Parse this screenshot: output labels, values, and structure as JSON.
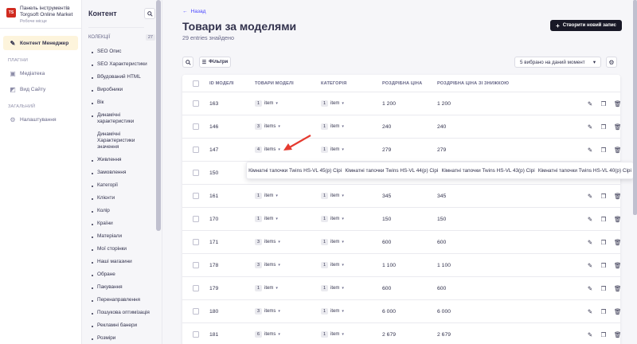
{
  "brand": {
    "title_line1": "Панель інструментів",
    "title_line2": "Torgsoft Online Market",
    "subtitle": "Робоче місце",
    "logo_text": "TS"
  },
  "nav": {
    "content_manager": "Контент Менеджер",
    "plugins_section": "ПЛАГІНИ",
    "media": "Медіатека",
    "site_view": "Вид Сайту",
    "general_section": "ЗАГАЛЬНИЙ",
    "settings": "Налаштування"
  },
  "subnav": {
    "title": "Контент",
    "collections_label": "КОЛЕКЦІЇ",
    "collections_count": "27",
    "items": [
      {
        "label": "SEO Опис"
      },
      {
        "label": "SEO Характеристики"
      },
      {
        "label": "Вбудований HTML"
      },
      {
        "label": "Виробники"
      },
      {
        "label": "Вік"
      },
      {
        "label": "Динамічні характеристики"
      },
      {
        "label": "Динамічні Характеристики значення"
      },
      {
        "label": "Живлення"
      },
      {
        "label": "Замовлення"
      },
      {
        "label": "Категорії"
      },
      {
        "label": "Клієнти"
      },
      {
        "label": "Колір"
      },
      {
        "label": "Країни"
      },
      {
        "label": "Матеріали"
      },
      {
        "label": "Мої сторінки"
      },
      {
        "label": "Наші магазини"
      },
      {
        "label": "Обране"
      },
      {
        "label": "Пакування"
      },
      {
        "label": "Перенаправлення"
      },
      {
        "label": "Пошукова оптимізація"
      },
      {
        "label": "Рекламні банери"
      },
      {
        "label": "Розміри"
      }
    ]
  },
  "main": {
    "back": "Назад",
    "title": "Товари за моделями",
    "subtitle": "29 entries знайдено",
    "create_button": "Створити новий запис",
    "filters_button": "Фільтри",
    "view_select": "5 вибрано на даний момент"
  },
  "table": {
    "headers": [
      "ID МОДЕЛІ",
      "ТОВАРИ МОДЕЛІ",
      "КАТЕГОРІЯ",
      "РОЗДРІБНА ЦІНА",
      "РОЗДРІБНА ЦІНА ЗІ ЗНИЖКОЮ"
    ],
    "rows": [
      {
        "id": "163",
        "items_count": "1",
        "items_label": "item",
        "cat_count": "1",
        "cat_label": "item",
        "price": "1 200",
        "sale": "1 200"
      },
      {
        "id": "146",
        "items_count": "3",
        "items_label": "items",
        "cat_count": "1",
        "cat_label": "item",
        "price": "240",
        "sale": "240"
      },
      {
        "id": "147",
        "items_count": "4",
        "items_label": "items",
        "cat_count": "1",
        "cat_label": "item",
        "price": "279",
        "sale": "279"
      },
      {
        "id": "150",
        "items_count": "",
        "items_label": "",
        "cat_count": "",
        "cat_label": "",
        "price": "",
        "sale": ""
      },
      {
        "id": "161",
        "items_count": "1",
        "items_label": "item",
        "cat_count": "1",
        "cat_label": "item",
        "price": "345",
        "sale": "345"
      },
      {
        "id": "170",
        "items_count": "1",
        "items_label": "item",
        "cat_count": "1",
        "cat_label": "item",
        "price": "150",
        "sale": "150"
      },
      {
        "id": "171",
        "items_count": "3",
        "items_label": "items",
        "cat_count": "1",
        "cat_label": "item",
        "price": "600",
        "sale": "600"
      },
      {
        "id": "178",
        "items_count": "3",
        "items_label": "items",
        "cat_count": "1",
        "cat_label": "item",
        "price": "1 100",
        "sale": "1 100"
      },
      {
        "id": "179",
        "items_count": "1",
        "items_label": "item",
        "cat_count": "1",
        "cat_label": "item",
        "price": "600",
        "sale": "600"
      },
      {
        "id": "180",
        "items_count": "3",
        "items_label": "items",
        "cat_count": "1",
        "cat_label": "item",
        "price": "6 000",
        "sale": "6 000"
      },
      {
        "id": "181",
        "items_count": "6",
        "items_label": "items",
        "cat_count": "1",
        "cat_label": "item",
        "price": "2 679",
        "sale": "2 679"
      }
    ]
  },
  "popover": {
    "items": [
      "Кімнатні тапочки Twins HS-VL 45(р) Сірі",
      "Кімнатні тапочки Twins HS-VL 44(р) Сірі",
      "Кімнатні тапочки Twins HS-VL 43(р) Сірі",
      "Кімнатні тапочки Twins HS-VL 40(р) Сірі"
    ]
  },
  "colors": {
    "accent": "#4945ff",
    "brand": "#d02b20",
    "active_nav": "#fdf4dc",
    "arrow": "#e53a2f",
    "dark_button": "#181826"
  }
}
